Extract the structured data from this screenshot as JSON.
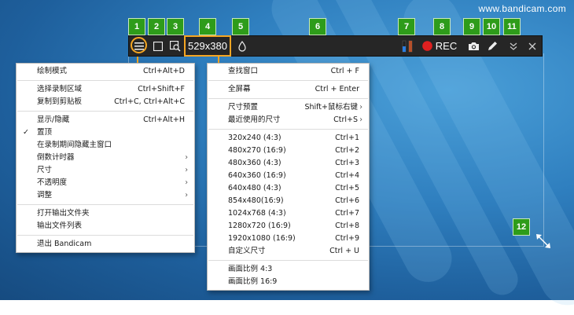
{
  "watermark": "www.bandicam.com",
  "colors": {
    "accent": "#f5a623",
    "badge": "#2e9c1a",
    "toolbar": "#262626",
    "rec": "#e02020"
  },
  "toolbar": {
    "size_label": "529x380",
    "rec_label": "REC",
    "icons": [
      "menu-icon",
      "fullscreen-icon",
      "search-window-icon",
      "opacity-icon",
      "audio-meter-icon",
      "record-icon",
      "camera-icon",
      "pen-icon",
      "collapse-icon",
      "close-icon"
    ]
  },
  "badges": [
    "1",
    "2",
    "3",
    "4",
    "5",
    "6",
    "7",
    "8",
    "9",
    "10",
    "11",
    "12"
  ],
  "main_menu": {
    "items": [
      {
        "label": "绘制模式",
        "shortcut": "Ctrl+Alt+D"
      },
      {
        "sep": true
      },
      {
        "label": "选择录制区域",
        "shortcut": "Ctrl+Shift+F"
      },
      {
        "label": "复制到剪贴板",
        "shortcut": "Ctrl+C, Ctrl+Alt+C"
      },
      {
        "sep": true
      },
      {
        "label": "显示/隐藏",
        "shortcut": "Ctrl+Alt+H"
      },
      {
        "label": "置顶",
        "checked": true
      },
      {
        "label": "在录制期间隐藏主窗口"
      },
      {
        "label": "倒数计时器",
        "submenu": true
      },
      {
        "label": "尺寸",
        "submenu": true
      },
      {
        "label": "不透明度",
        "submenu": true
      },
      {
        "label": "调整",
        "submenu": true
      },
      {
        "sep": true
      },
      {
        "label": "打开输出文件夹"
      },
      {
        "label": "输出文件列表"
      },
      {
        "sep": true
      },
      {
        "label": "退出 Bandicam"
      }
    ]
  },
  "size_menu": {
    "items": [
      {
        "label": "查找窗口",
        "shortcut": "Ctrl + F"
      },
      {
        "sep": true
      },
      {
        "label": "全屏幕",
        "shortcut": "Ctrl + Enter"
      },
      {
        "sep": true
      },
      {
        "label": "尺寸预置",
        "shortcut": "Shift+鼠标右键",
        "submenu": true
      },
      {
        "label": "最近使用的尺寸",
        "shortcut": "Ctrl+S",
        "submenu": true
      },
      {
        "sep": true
      },
      {
        "label": "320x240 (4:3)",
        "shortcut": "Ctrl+1"
      },
      {
        "label": "480x270 (16:9)",
        "shortcut": "Ctrl+2"
      },
      {
        "label": "480x360 (4:3)",
        "shortcut": "Ctrl+3"
      },
      {
        "label": "640x360 (16:9)",
        "shortcut": "Ctrl+4"
      },
      {
        "label": "640x480 (4:3)",
        "shortcut": "Ctrl+5"
      },
      {
        "label": "854x480(16:9)",
        "shortcut": "Ctrl+6"
      },
      {
        "label": "1024x768 (4:3)",
        "shortcut": "Ctrl+7"
      },
      {
        "label": "1280x720 (16:9)",
        "shortcut": "Ctrl+8"
      },
      {
        "label": "1920x1080 (16:9)",
        "shortcut": "Ctrl+9"
      },
      {
        "label": "自定义尺寸",
        "shortcut": "Ctrl + U"
      },
      {
        "sep": true
      },
      {
        "label": "画面比例 4:3"
      },
      {
        "label": "画面比例 16:9"
      }
    ]
  }
}
